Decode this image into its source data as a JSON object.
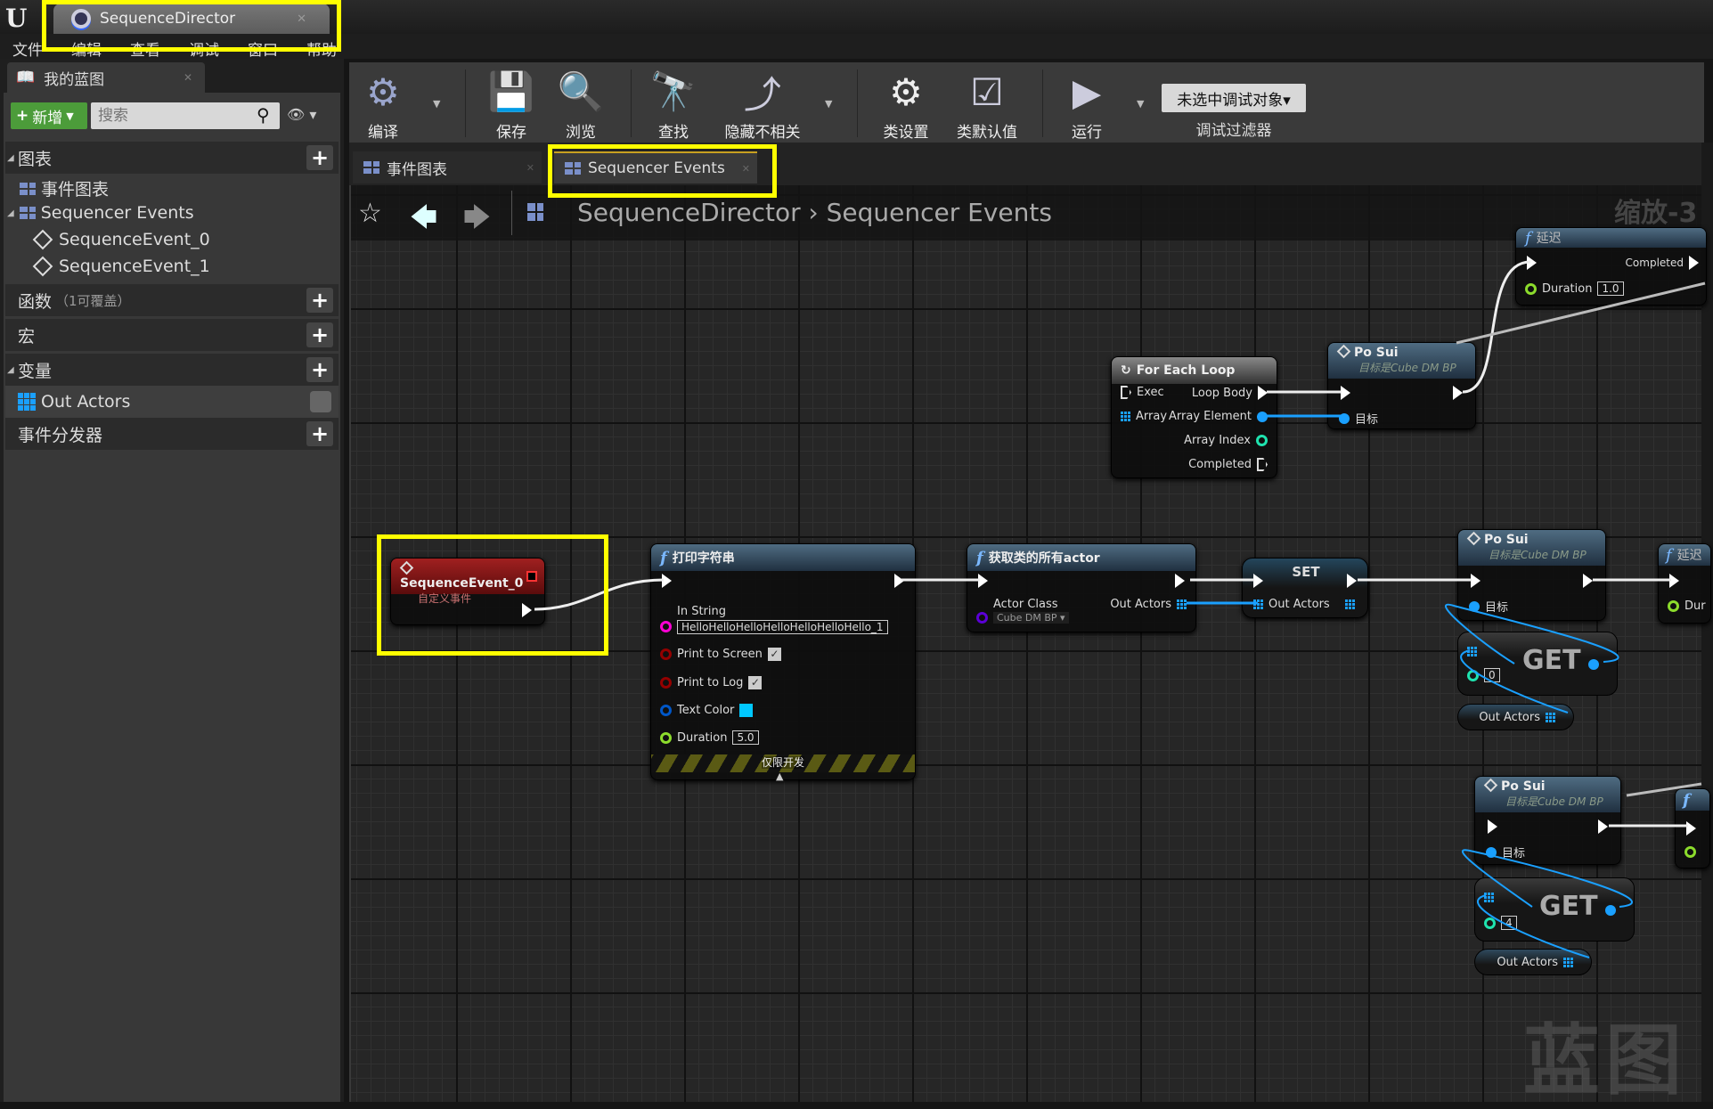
{
  "window": {
    "tab_title": "SequenceDirector",
    "logo": "U"
  },
  "menu": [
    "文件",
    "编辑",
    "查看",
    "调试",
    "窗口",
    "帮助"
  ],
  "my_blueprint": {
    "tab_label": "我的蓝图",
    "new_button": "新增",
    "search_placeholder": "搜索",
    "sections": {
      "graphs": "图表",
      "functions": "函数",
      "functions_sub": "（1可覆盖）",
      "macros": "宏",
      "variables": "变量",
      "dispatchers": "事件分发器"
    },
    "graph_items": [
      "事件图表",
      "Sequencer Events"
    ],
    "event_items": [
      "SequenceEvent_0",
      "SequenceEvent_1"
    ],
    "variable_items": [
      "Out Actors"
    ]
  },
  "toolbar": {
    "compile": "编译",
    "save": "保存",
    "browse": "浏览",
    "find": "查找",
    "hide_unrelated": "隐藏不相关",
    "class_settings": "类设置",
    "class_defaults": "类默认值",
    "play": "运行",
    "debug_object": "未选中调试对象▾",
    "debug_filter": "调试过滤器"
  },
  "graph_tabs": [
    "事件图表",
    "Sequencer Events"
  ],
  "breadcrumb": {
    "root": "SequenceDirector",
    "separator": "›",
    "current": "Sequencer Events"
  },
  "zoom_label": "缩放-3",
  "watermark": "蓝图",
  "nodes": {
    "event": {
      "title": "SequenceEvent_0",
      "subtitle": "自定义事件"
    },
    "print": {
      "title": "打印字符串",
      "in_string_label": "In String",
      "in_string": "HelloHelloHelloHelloHelloHelloHello_1",
      "print_to_screen": "Print to Screen",
      "print_to_screen_checked": true,
      "print_to_log": "Print to Log",
      "print_to_log_checked": true,
      "text_color_label": "Text Color",
      "text_color": "#00c8ff",
      "duration_label": "Duration",
      "duration": "5.0",
      "dev_only": "仅限开发"
    },
    "get_all": {
      "title": "获取类的所有actor",
      "actor_class": "Actor Class",
      "class_value": "Cube DM BP ▾",
      "out_actors": "Out Actors"
    },
    "set": {
      "title": "SET",
      "out_actors": "Out Actors"
    },
    "foreach": {
      "title": "For Each Loop",
      "exec": "Exec",
      "array": "Array",
      "loop_body": "Loop Body",
      "array_element": "Array Element",
      "array_index": "Array Index",
      "completed": "Completed"
    },
    "posui": {
      "title": "Po Sui",
      "subtitle": "目标是Cube DM BP",
      "target": "目标"
    },
    "delay": {
      "title": "延迟",
      "completed": "Completed",
      "duration_label": "Duration",
      "duration": "1.0",
      "partial_duration": "Dur"
    },
    "get1": {
      "label": "GET",
      "index": "0"
    },
    "get2": {
      "label": "GET",
      "index": "4"
    },
    "var_out_actors": "Out Actors"
  },
  "colors": {
    "exec": "#ffffff",
    "object": "#1aa0ff",
    "string": "#ff00d4",
    "bool": "#940000",
    "float": "#8cdc2c",
    "int": "#1fe3af",
    "struct": "#0057c8",
    "class": "#5b00d6",
    "highlight": "#ffff00",
    "event_header": "#8a1010"
  }
}
